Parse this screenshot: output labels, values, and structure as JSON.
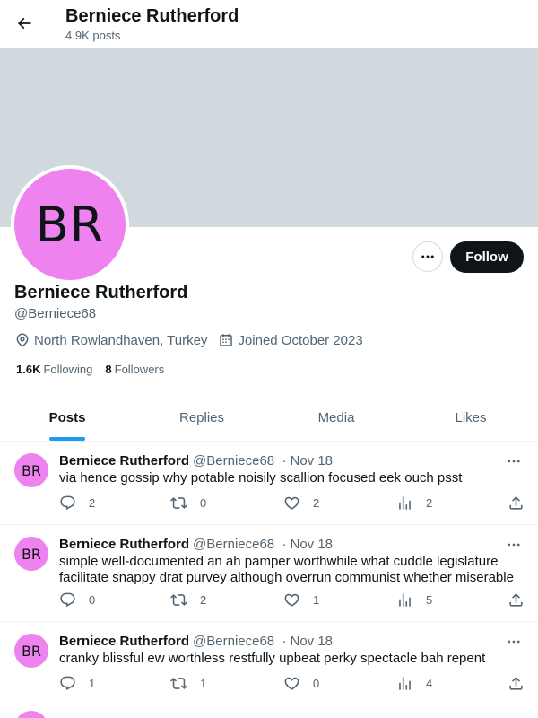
{
  "header": {
    "name": "Berniece Rutherford",
    "post_count": "4.9K posts"
  },
  "profile": {
    "avatar_initials": "BR",
    "avatar_color": "#ee82ee",
    "banner_color": "#cfd9de",
    "name": "Berniece Rutherford",
    "handle": "@Berniece68",
    "location": "North Rowlandhaven, Turkey",
    "joined": "Joined October 2023",
    "following_count": "1.6K",
    "following_label": "Following",
    "followers_count": "8",
    "followers_label": "Followers",
    "follow_button": "Follow"
  },
  "tabs": [
    {
      "label": "Posts",
      "active": true
    },
    {
      "label": "Replies",
      "active": false
    },
    {
      "label": "Media",
      "active": false
    },
    {
      "label": "Likes",
      "active": false
    }
  ],
  "posts": [
    {
      "initials": "BR",
      "name": "Berniece Rutherford",
      "handle": "@Berniece68",
      "date": "· Nov 18",
      "text": "via hence gossip why potable noisily scallion focused eek ouch psst",
      "replies": "2",
      "reposts": "0",
      "likes": "2",
      "views": "2"
    },
    {
      "initials": "BR",
      "name": "Berniece Rutherford",
      "handle": "@Berniece68",
      "date": "· Nov 18",
      "text": "simple well-documented an ah pamper worthwhile what cuddle legislature facilitate snappy drat purvey although overrun communist whether miserable",
      "replies": "0",
      "reposts": "2",
      "likes": "1",
      "views": "5"
    },
    {
      "initials": "BR",
      "name": "Berniece Rutherford",
      "handle": "@Berniece68",
      "date": "· Nov 18",
      "text": "cranky blissful ew worthless restfully upbeat perky spectacle bah repent",
      "replies": "1",
      "reposts": "1",
      "likes": "0",
      "views": "4"
    }
  ],
  "colors": {
    "accent": "#1d9bf0",
    "text_primary": "#0f1419",
    "text_secondary": "#536471"
  }
}
